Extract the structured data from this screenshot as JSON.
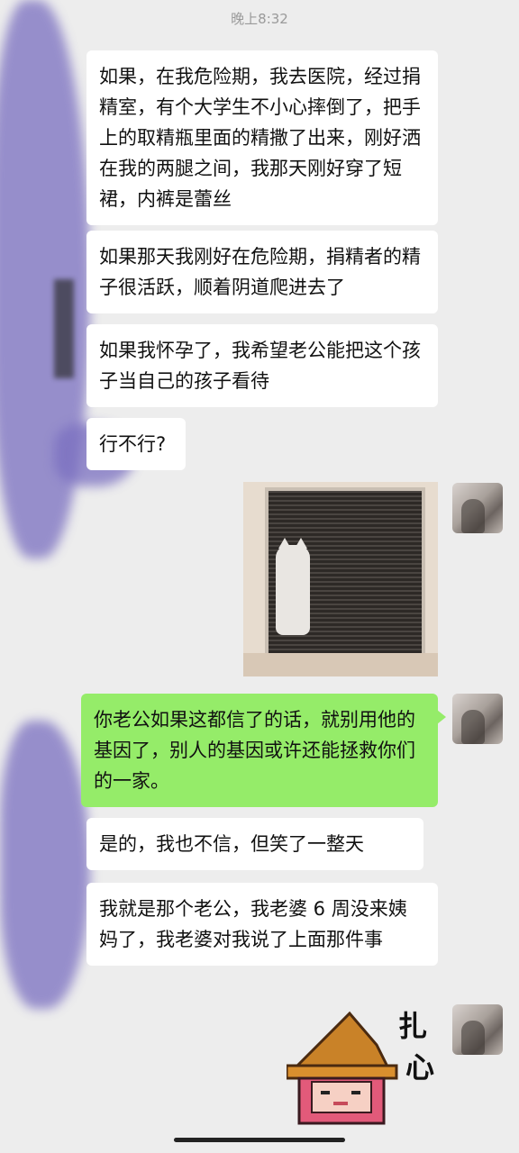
{
  "status": {
    "time": "晚上8:32"
  },
  "messages": [
    {
      "text": "如果，在我危险期，我去医院，经过捐精室，有个大学生不小心摔倒了，把手上的取精瓶里面的精撒了出来，刚好洒在我的两腿之间，我那天刚好穿了短裙，内裤是蕾丝"
    },
    {
      "text": "如果那天我刚好在危险期，捐精者的精子很活跃，顺着阴道爬进去了"
    },
    {
      "text": "如果我怀孕了，我希望老公能把这个孩子当自己的孩子看待"
    },
    {
      "text": "行不行?"
    },
    {
      "text": "你老公如果这都信了的话，就别用他的基因了，别人的基因或许还能拯救你们的一家。"
    },
    {
      "text": "是的，我也不信，但笑了一整天"
    },
    {
      "text": "我就是那个老公，我老婆 6 周没来姨妈了，我老婆对我说了上面那件事"
    }
  ],
  "sticker": {
    "caption_1": "扎",
    "caption_2": "心"
  },
  "colors": {
    "background": "#ededed",
    "outgoing_bubble": "#95ec69",
    "incoming_bubble": "#ffffff"
  }
}
